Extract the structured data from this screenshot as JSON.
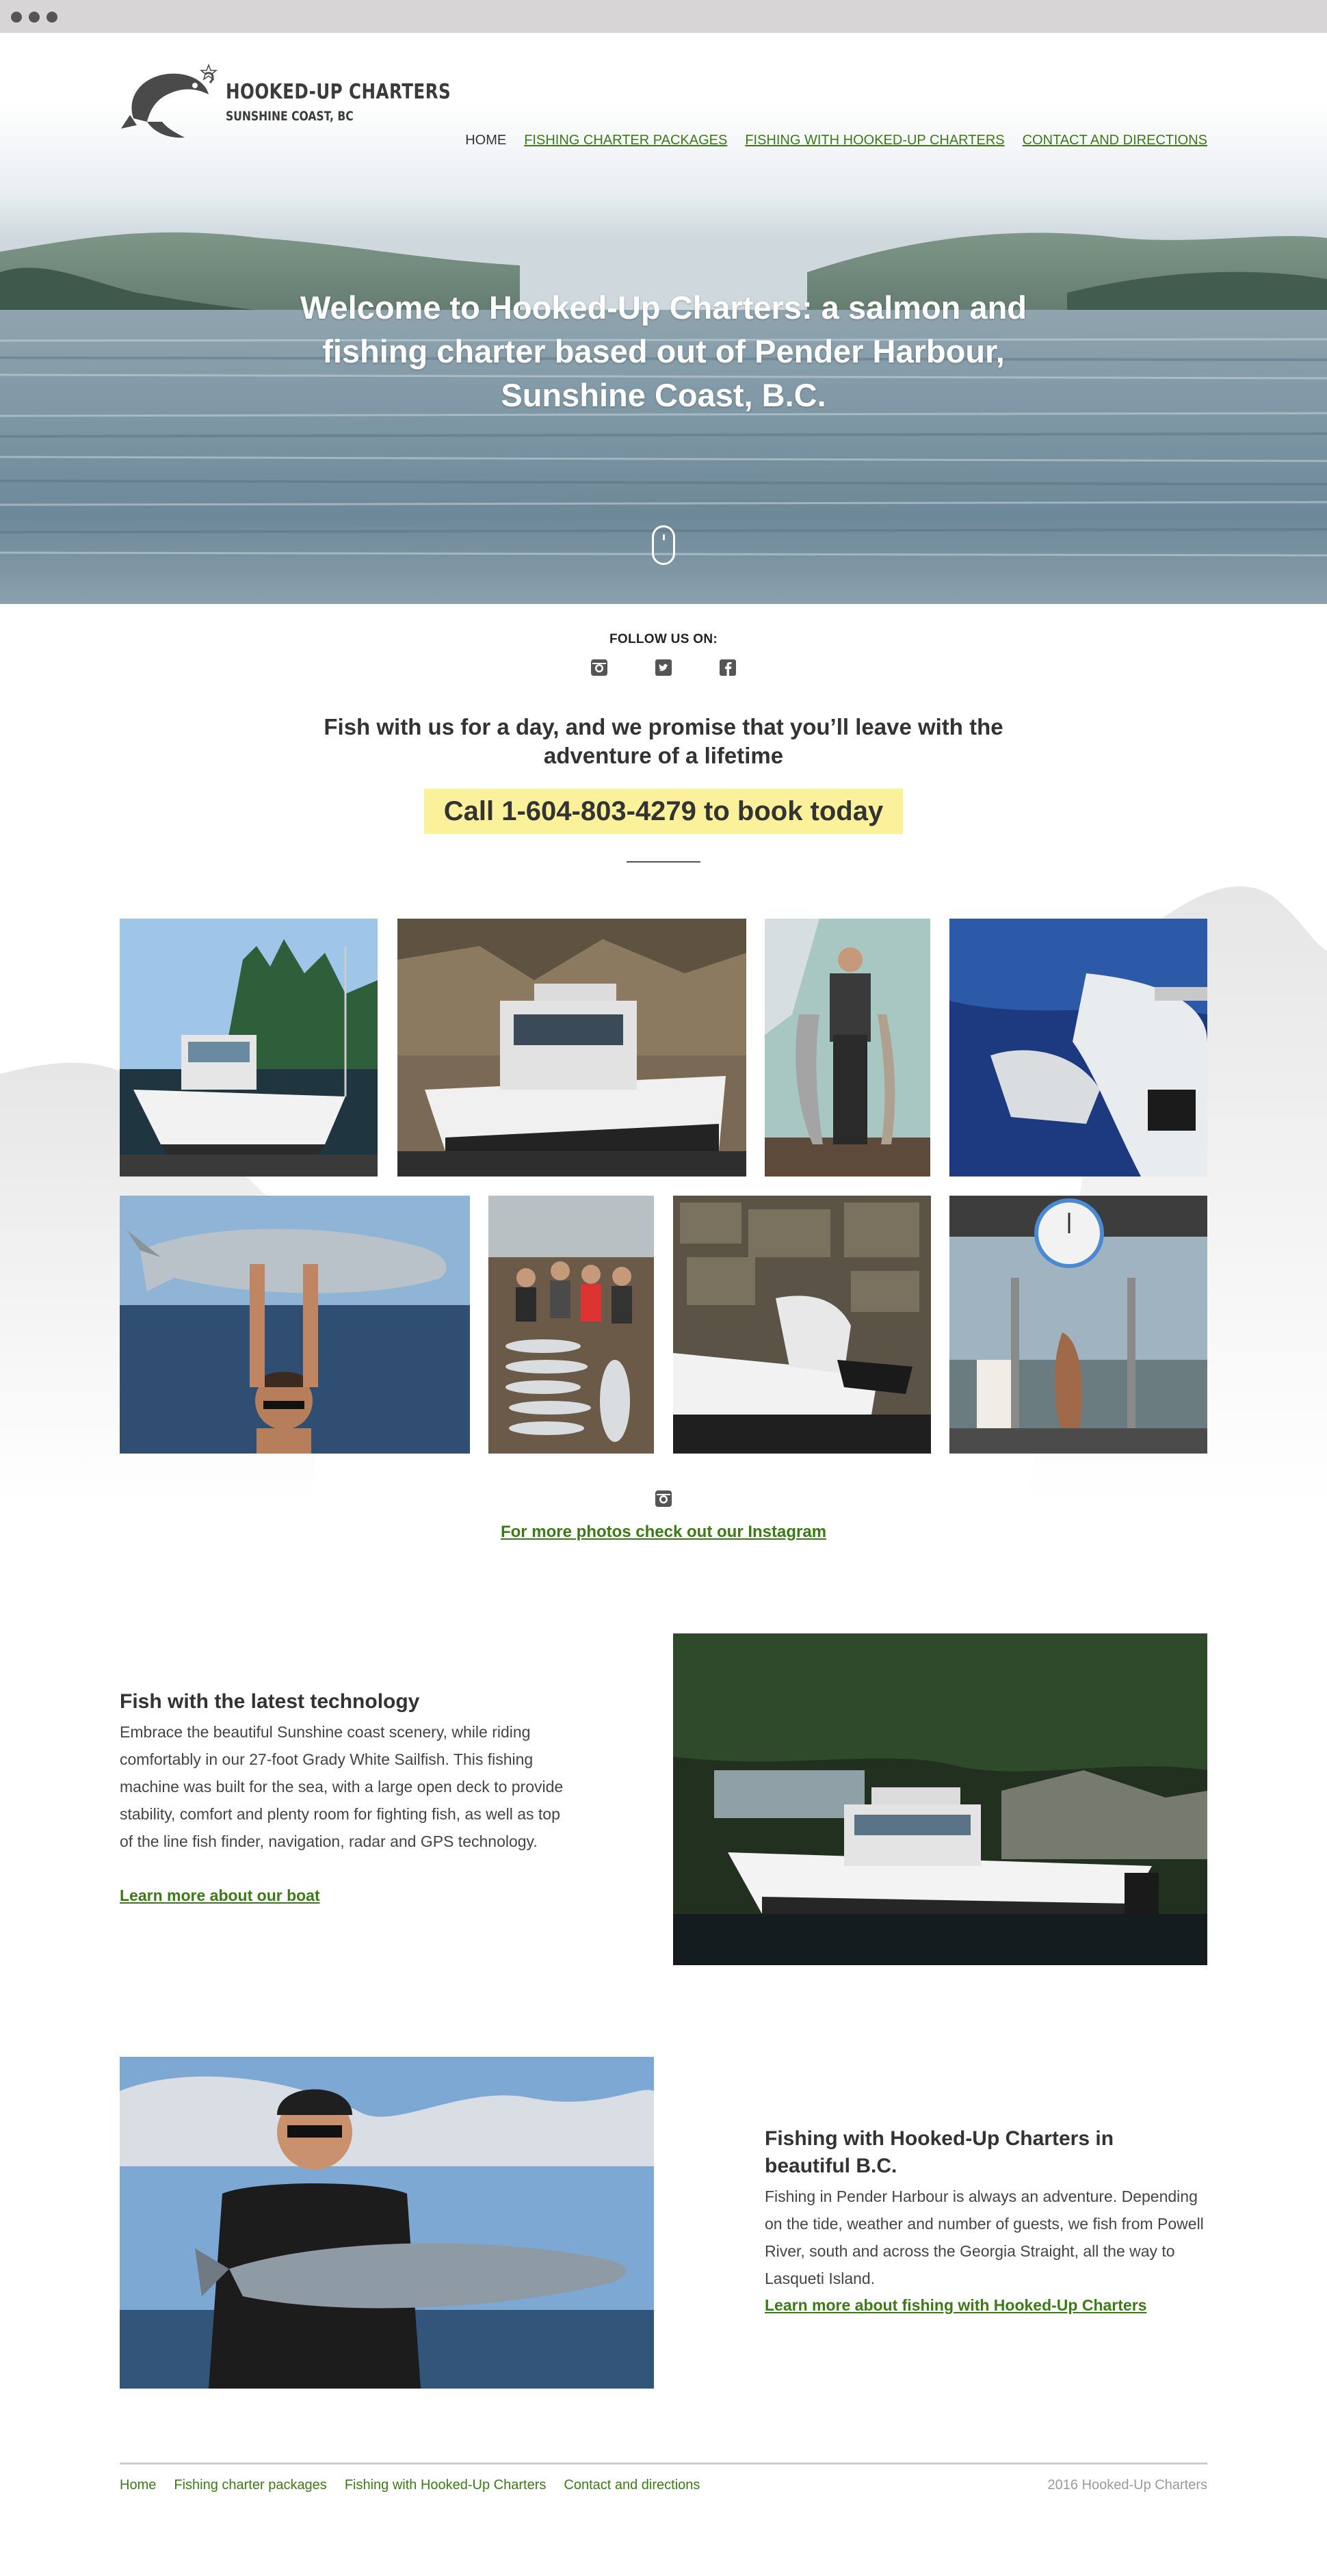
{
  "brand": {
    "name": "HOOKED-UP CHARTERS",
    "location": "SUNSHINE COAST, BC"
  },
  "nav": {
    "items": [
      {
        "label": "HOME"
      },
      {
        "label": "FISHING CHARTER PACKAGES"
      },
      {
        "label": "FISHING WITH HOOKED-UP CHARTERS"
      },
      {
        "label": "CONTACT AND DIRECTIONS"
      }
    ]
  },
  "hero": {
    "title": "Welcome to Hooked-Up Charters: a salmon and fishing charter based out of Pender Harbour, Sunshine Coast, B.C."
  },
  "social": {
    "heading": "FOLLOW US ON:",
    "icons": [
      "instagram-icon",
      "twitter-icon",
      "facebook-icon"
    ]
  },
  "intro": {
    "tagline": "Fish with us for a day, and we promise that you’ll leave with the adventure of a lifetime",
    "call_to_action": "Call 1-604-803-4279 to book today"
  },
  "gallery": {
    "more_link": "For more photos check out our Instagram"
  },
  "section_technology": {
    "heading": "Fish with the latest technology",
    "body": "Embrace the beautiful Sunshine coast scenery, while riding comfortably in our 27-foot Grady White Sailfish. This fishing machine was built for the sea, with a large open deck to provide stability, comfort and plenty room for fighting fish, as well as top of the line fish finder, navigation, radar and GPS technology.",
    "link": "Learn more about our boat"
  },
  "section_fishing": {
    "heading": "Fishing with Hooked-Up Charters in beautiful B.C.",
    "body": "Fishing in Pender Harbour is always an adventure. Depending on the tide, weather and number of guests, we fish from Powell River, south and across the Georgia Straight, all the way to Lasqueti Island.",
    "link": "Learn more about fishing with Hooked-Up Charters"
  },
  "footer": {
    "links": [
      "Home",
      "Fishing charter packages",
      "Fishing with Hooked-Up Charters",
      "Contact and directions"
    ],
    "copyright": "2016 Hooked-Up Charters"
  },
  "colors": {
    "link_green": "#3c7a18",
    "callout_yellow": "#fbf19a",
    "text_dark": "#333333"
  }
}
